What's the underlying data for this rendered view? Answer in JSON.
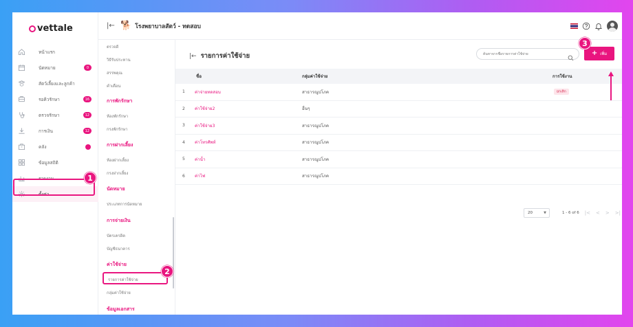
{
  "app": {
    "logo": "vettale",
    "clinic_name": "โรงพยาบาลสัตว์ - ทดสอบ"
  },
  "sidebar": {
    "items": [
      {
        "label": "หน้าแรก",
        "icon": "home-icon"
      },
      {
        "label": "นัดหมาย",
        "icon": "calendar-icon",
        "badge": "0"
      },
      {
        "label": "สัตว์เลี้ยงและลูกค้า",
        "icon": "paw-icon"
      },
      {
        "label": "รอคิวรักษา",
        "icon": "queue-icon",
        "badge": "16"
      },
      {
        "label": "ตรวจรักษา",
        "icon": "stethoscope-icon",
        "badge": "12"
      },
      {
        "label": "การเงิน",
        "icon": "finance-icon",
        "badge": "12"
      },
      {
        "label": "คลัง",
        "icon": "inventory-icon",
        "badge": ""
      },
      {
        "label": "ข้อมูลสถิติ",
        "icon": "stats-icon"
      },
      {
        "label": "รายงาน",
        "icon": "report-icon"
      },
      {
        "label": "ตั้งค่า",
        "icon": "settings-icon"
      }
    ]
  },
  "submenu": {
    "top_items": [
      "ตรวจดี",
      "วิธีรับประทาน",
      "สรรพคุณ",
      "คำเตือน"
    ],
    "sections": [
      {
        "title": "การพักรักษา",
        "items": [
          "ห้องพักรักษา",
          "กรงพักรักษา"
        ]
      },
      {
        "title": "การฝากเลี้ยง",
        "items": [
          "ห้องฝากเลี้ยง",
          "กรงฝากเลี้ยง"
        ]
      },
      {
        "title": "นัดหมาย",
        "items": [
          "ประเภทการนัดหมาย"
        ]
      },
      {
        "title": "การจ่ายเงิน",
        "items": [
          "บัตรเครดิต",
          "บัญชีธนาคาร"
        ]
      },
      {
        "title": "ค่าใช้จ่าย",
        "items": [
          "รายการค่าใช้จ่าย",
          "กลุ่มค่าใช้จ่าย"
        ]
      },
      {
        "title": "ข้อมูลเอกสาร",
        "items": []
      }
    ]
  },
  "main": {
    "title": "รายการค่าใช้จ่าย",
    "search_placeholder": "ค้นหาจากชื่อรายการค่าใช้จ่าย",
    "add_label": "เพิ่ม",
    "columns": {
      "name": "ชื่อ",
      "group": "กลุ่มค่าใช้จ่าย",
      "usage": "การใช้งาน"
    },
    "rows": [
      {
        "no": "1",
        "name": "ค่าจ่ายทดสอบ",
        "group": "สาธารณูปโภค",
        "usage": "ยกเลิก"
      },
      {
        "no": "2",
        "name": "ค่าใช้จ่าย2",
        "group": "อื่นๆ",
        "usage": ""
      },
      {
        "no": "3",
        "name": "ค่าใช้จ่าย3",
        "group": "สาธารณูปโภค",
        "usage": ""
      },
      {
        "no": "4",
        "name": "ค่าโทรศัพท์",
        "group": "สาธารณูปโภค",
        "usage": ""
      },
      {
        "no": "5",
        "name": "ค่าน้ำ",
        "group": "สาธารณูปโภค",
        "usage": ""
      },
      {
        "no": "6",
        "name": "ค่าไฟ",
        "group": "สาธารณูปโภค",
        "usage": ""
      }
    ],
    "page_size": "20",
    "page_range": "1 - 6 of 6"
  },
  "steps": [
    "1",
    "2",
    "3"
  ],
  "colors": {
    "accent": "#e9157f",
    "cancel_tag_bg": "#fde4ea",
    "cancel_tag_text": "#d6244b"
  }
}
